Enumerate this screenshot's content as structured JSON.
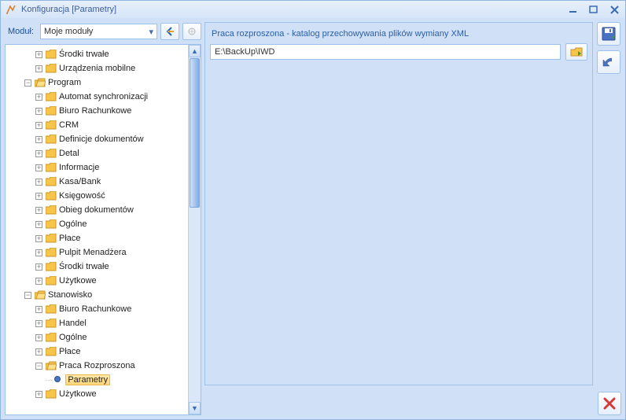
{
  "window": {
    "title": "Konfiguracja [Parametry]"
  },
  "modbar": {
    "label": "Moduł:",
    "selected": "Moje moduły"
  },
  "tree": {
    "n0": "Środki trwałe",
    "n1": "Urządzenia mobilne",
    "n2": "Program",
    "n3": "Automat synchronizacji",
    "n4": "Biuro Rachunkowe",
    "n5": "CRM",
    "n6": "Definicje dokumentów",
    "n7": "Detal",
    "n8": "Informacje",
    "n9": "Kasa/Bank",
    "n10": "Księgowość",
    "n11": "Obieg dokumentów",
    "n12": "Ogólne",
    "n13": "Płace",
    "n14": "Pulpit Menadżera",
    "n15": "Środki trwałe",
    "n16": "Użytkowe",
    "n17": "Stanowisko",
    "n18": "Biuro Rachunkowe",
    "n19": "Handel",
    "n20": "Ogólne",
    "n21": "Płace",
    "n22": "Praca Rozproszona",
    "n23": "Parametry",
    "n24": "Użytkowe"
  },
  "panel": {
    "group_title": "Praca rozproszona - katalog przechowywania plików wymiany XML",
    "path_value": "E:\\BackUp\\IWD"
  }
}
